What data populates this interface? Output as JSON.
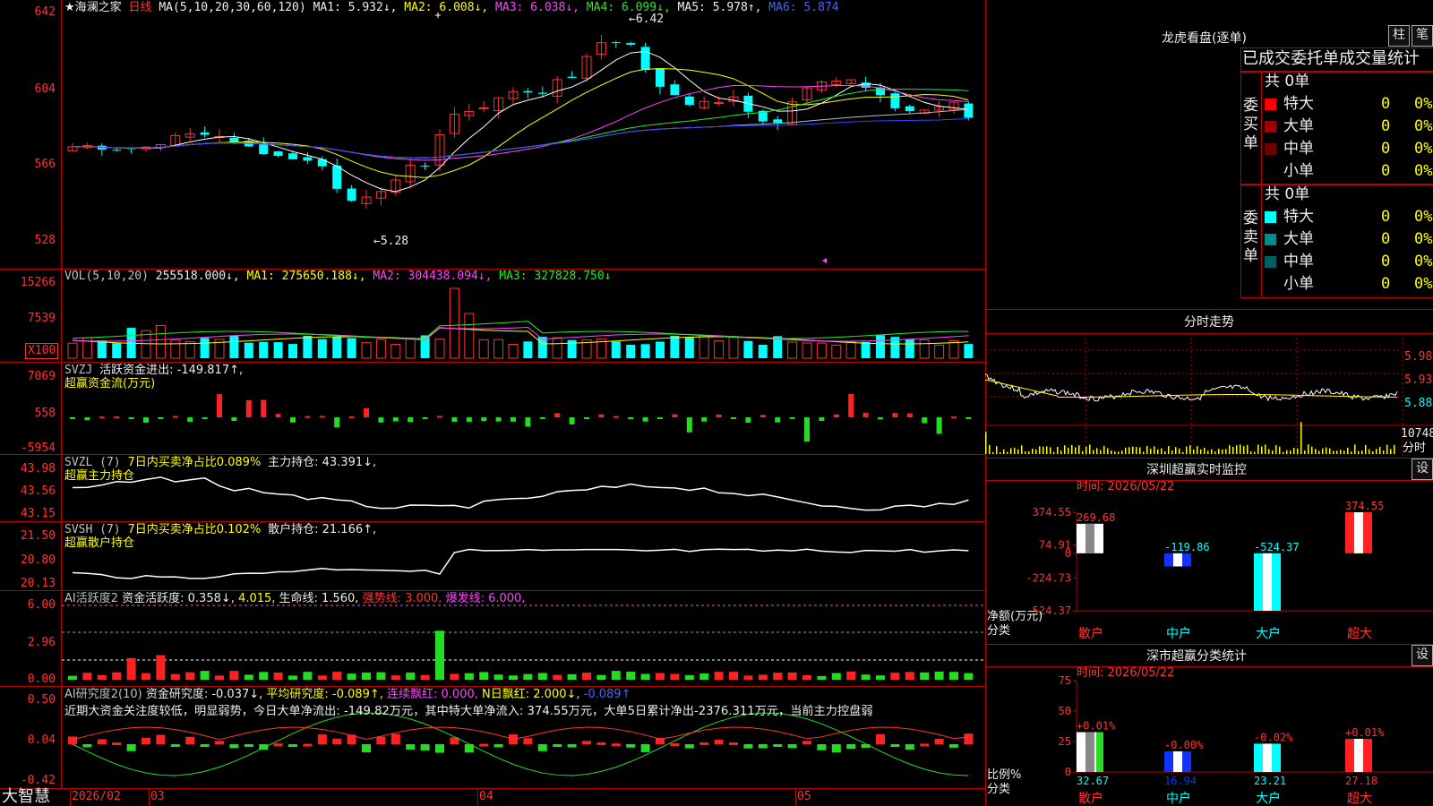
{
  "kline": {
    "title": "海澜之家",
    "period": "日线",
    "ma_label": "MA(5,10,20,30,60,120)",
    "ma1": "MA1: 5.932↓,",
    "ma2": "MA2: 6.008↓,",
    "ma3": "MA3: 6.038↓,",
    "ma4": "MA4: 6.099↓,",
    "ma5": "MA5: 5.978↑,",
    "ma6": "MA6: 5.874",
    "high_label": "6.42",
    "low_label": "5.28",
    "yticks": [
      "642",
      "604",
      "566",
      "528"
    ]
  },
  "vol": {
    "label": "VOL(5,10,20)",
    "value": "255518.000↓,",
    "ma1": "MA1: 275650.188↓,",
    "ma2": "MA2: 304438.094↓,",
    "ma3": "MA3: 327828.750↓",
    "yticks": [
      "15266",
      "7539"
    ],
    "unit": "X100"
  },
  "svzj": {
    "label": "SVZJ",
    "desc": "活跃资金进出: -149.817↑,",
    "sub": "超赢资金流(万元)",
    "yticks": [
      "7069",
      "558",
      "-5954"
    ]
  },
  "svzl": {
    "label": "SVZL (7)",
    "desc": "7日内买卖净占比0.089%",
    "hold": "主力持仓: 43.391↓,",
    "sub": "超赢主力持仓",
    "yticks": [
      "43.98",
      "43.56",
      "43.15"
    ]
  },
  "svsh": {
    "label": "SVSH (7)",
    "desc": "7日内买卖净占比0.102%",
    "hold": "散户持仓: 21.166↑,",
    "sub": "超赢散户持仓",
    "yticks": [
      "21.50",
      "20.80",
      "20.13"
    ]
  },
  "ai1": {
    "label": "AI活跃度2",
    "v1": "资金活跃度: 0.358↓,",
    "v2": "4.015,",
    "v3": "生命线: 1.560,",
    "v4": "强势线: 3.000,",
    "v5": "爆发线: 6.000,",
    "yticks": [
      "6.00",
      "2.96",
      "0.00"
    ]
  },
  "ai2": {
    "label": "AI研究度2(10)",
    "v1": "资金研究度: -0.037↓,",
    "v2": "平均研究度: -0.089↑,",
    "v3": "连续飘红: 0.000,",
    "v4": "N日飘红: 2.000↓,",
    "v5": "-0.089↑",
    "comment": "近期大资金关注度较低，明显弱势，今日大单净流出: -149.82万元，其中特大单净流入: 374.55万元，大单5日累计净出-2376.311万元，当前主力控盘弱",
    "yticks": [
      "0.50",
      "0.04",
      "-0.42"
    ]
  },
  "xaxis": {
    "brand": "大智慧",
    "labels": [
      "2026/02",
      "03",
      "04",
      "05"
    ]
  },
  "right": {
    "lhkp_title": "龙虎看盘(逐单)",
    "btn_zhu": "柱",
    "btn_bi": "笔",
    "stat_title": "已成交委托单成交量统计",
    "buy_side": "委买单",
    "sell_side": "委卖单",
    "buy_total": "共 0单",
    "sell_total": "共 0单",
    "buy_rows": [
      {
        "label": "特大",
        "val": "0",
        "pct": "0%",
        "color": "#ff0000"
      },
      {
        "label": "大单",
        "val": "0",
        "pct": "0%",
        "color": "#a00000"
      },
      {
        "label": "中单",
        "val": "0",
        "pct": "0%",
        "color": "#700000"
      },
      {
        "label": "小单",
        "val": "0",
        "pct": "0%",
        "color": ""
      }
    ],
    "sell_rows": [
      {
        "label": "特大",
        "val": "0",
        "pct": "0%",
        "color": "#00ffff"
      },
      {
        "label": "大单",
        "val": "0",
        "pct": "0%",
        "color": "#008c8c"
      },
      {
        "label": "中单",
        "val": "0",
        "pct": "0%",
        "color": "#006060"
      },
      {
        "label": "小单",
        "val": "0",
        "pct": "0%",
        "color": ""
      }
    ],
    "fenshi_title": "分时走势",
    "fenshi_prices": [
      "5.98",
      "5.93",
      "5.88"
    ],
    "fenshi_vol": "10748",
    "fenshi_label": "分时",
    "sz_title": "深圳超赢实时监控",
    "sz_btn": "设",
    "sz_time": "时间: 2026/05/22",
    "sz_yticks": [
      "374.55",
      "74.91",
      "0",
      "-224.73",
      "-524.37"
    ],
    "sz_unit1": "净额(万元)",
    "sz_unit2": "分类",
    "fl_title": "深市超赢分类统计",
    "fl_btn": "设",
    "fl_time": "时间: 2026/05/22",
    "fl_yticks": [
      "75",
      "50",
      "25",
      "0"
    ],
    "fl_unit1": "比例%",
    "fl_unit2": "分类",
    "categories": [
      "散户",
      "中户",
      "大户",
      "超大"
    ]
  },
  "chart_data": [
    {
      "type": "candlestick",
      "title": "海澜之家 日线",
      "ylim": [
        5.28,
        6.42
      ],
      "ma_values": {
        "MA1": 5.932,
        "MA2": 6.008,
        "MA3": 6.038,
        "MA4": 6.099,
        "MA5": 5.978,
        "MA6": 5.874
      },
      "high": 6.42,
      "low": 5.28,
      "x_labels": [
        "2026/02",
        "03",
        "04",
        "05"
      ]
    },
    {
      "type": "bar",
      "title": "深圳超赢实时监控",
      "categories": [
        "散户",
        "中户",
        "大户",
        "超大"
      ],
      "values": [
        269.68,
        -119.86,
        -524.37,
        374.55
      ],
      "ylim": [
        -524.37,
        374.55
      ],
      "ylabel": "净额(万元)"
    },
    {
      "type": "bar",
      "title": "深市超赢分类统计",
      "categories": [
        "散户",
        "中户",
        "大户",
        "超大"
      ],
      "values": [
        32.67,
        16.94,
        23.21,
        27.18
      ],
      "changes": [
        "+0.01%",
        "-0.00%",
        "-0.02%",
        "+0.01%"
      ],
      "ylim": [
        0,
        75
      ],
      "ylabel": "比例%"
    }
  ]
}
